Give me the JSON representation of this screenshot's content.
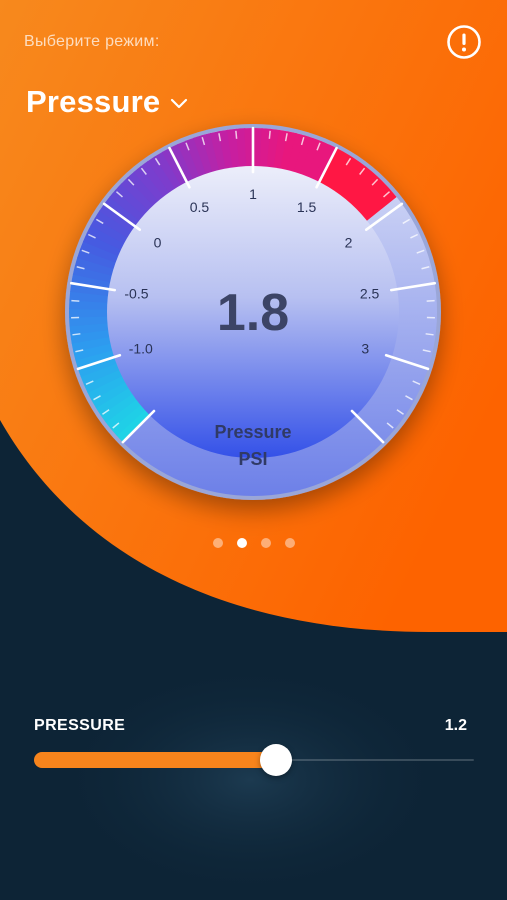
{
  "header": {
    "mode_prompt": "Выберите режим:",
    "mode_value": "Pressure",
    "info_icon": "exclamation-circle-icon"
  },
  "gauge": {
    "value_display": "1.8",
    "label": "Pressure",
    "unit": "PSI",
    "scale_min": -1.5,
    "scale_max": 3.5,
    "needle_value": 1.8,
    "tick_labels": [
      "-1.0",
      "-0.5",
      "0",
      "0.5",
      "1",
      "1.5",
      "2",
      "2.5",
      "3"
    ],
    "colors": {
      "arc_low": "#1fd3e6",
      "arc_mid": "#2c8ff0",
      "arc_high": "#7b3fd0",
      "arc_top": "#e8177d",
      "arc_danger": "#ff1744",
      "face_top": "#e6e9f9",
      "face_bottom": "#3451e8"
    }
  },
  "pager": {
    "count": 4,
    "active_index": 1
  },
  "slider": {
    "name": "PRESSURE",
    "value": "1.2",
    "fraction": 0.55,
    "fill_color": "#f7841c"
  },
  "theme": {
    "orange": "#fa6a0a",
    "navy": "#0d2436"
  }
}
